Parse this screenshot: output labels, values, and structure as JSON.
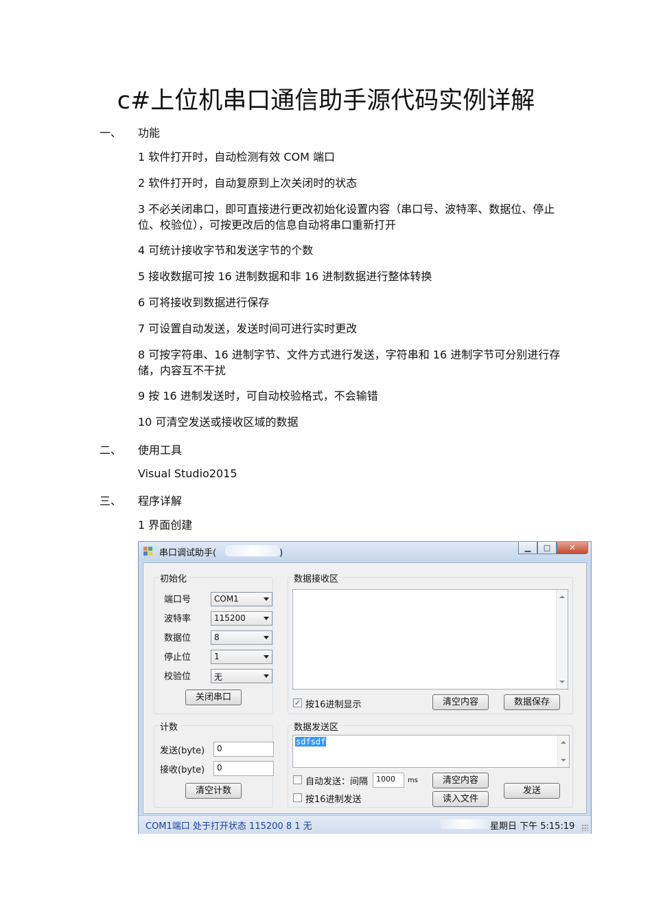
{
  "doc": {
    "title": "c#上位机串口通信助手源代码实例详解",
    "sections": [
      {
        "num": "一、",
        "heading": "功能"
      },
      {
        "num": "二、",
        "heading": "使用工具"
      },
      {
        "num": "三、",
        "heading": "程序详解"
      }
    ],
    "features": [
      "1 软件打开时，自动检测有效 COM 端口",
      "2 软件打开时，自动复原到上次关闭时的状态",
      "3 不必关闭串口，即可直接进行更改初始化设置内容（串口号、波特率、数据位、停止位、校验位），可按更改后的信息自动将串口重新打开",
      "4 可统计接收字节和发送字节的个数",
      "5 接收数据可按 16 进制数据和非 16 进制数据进行整体转换",
      "6 可将接收到数据进行保存",
      "7 可设置自动发送，发送时间可进行实时更改",
      "8 可按字符串、16 进制字节、文件方式进行发送，字符串和 16 进制字节可分别进行存储，内容互不干扰",
      "9 按 16 进制发送时，可自动校验格式，不会输错",
      "10 可清空发送或接收区域的数据"
    ],
    "tool": "Visual Studio2015",
    "sub_heading": "1 界面创建"
  },
  "window": {
    "title": "串口调试助手(",
    "title_end": ")",
    "init_group": "初始化",
    "fields": [
      {
        "label": "端口号",
        "value": "COM1"
      },
      {
        "label": "波特率",
        "value": "115200"
      },
      {
        "label": "数据位",
        "value": "8"
      },
      {
        "label": "停止位",
        "value": "1"
      },
      {
        "label": "校验位",
        "value": "无"
      }
    ],
    "close_port": "关闭串口",
    "count_group": "计数",
    "send_label": "发送(byte)",
    "send_value": "0",
    "recv_label": "接收(byte)",
    "recv_value": "0",
    "clear_count": "清空计数",
    "recv_group": "数据接收区",
    "hex_display": "按16进制显示",
    "clear_recv": "清空内容",
    "save_data": "数据保存",
    "send_group": "数据发送区",
    "send_text": "sdfsdf",
    "auto_send": "自动发送：间隔",
    "interval": "1000",
    "ms": "ms",
    "hex_send": "按16进制发送",
    "clear_send": "清空内容",
    "read_file": "读入文件",
    "send_btn": "发送",
    "status_left": "COM1端口 处于打开状态 115200 8 1 无",
    "status_right": "星期日 下午 5:15:19"
  },
  "colors": {
    "accent": "#1a3f9e",
    "selection": "#3399ff"
  }
}
